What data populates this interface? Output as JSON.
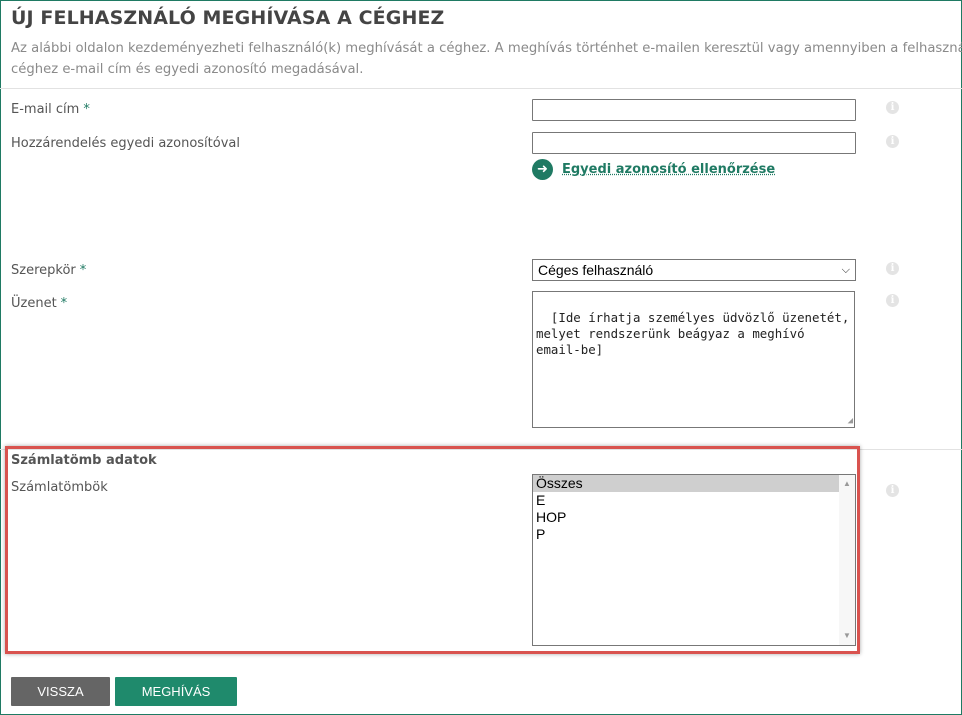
{
  "page": {
    "title": "ÚJ FELHASZNÁLÓ MEGHÍVÁSA A CÉGHEZ",
    "description_line1": "Az alábbi oldalon kezdeményezheti felhasználó(k) meghívását a céghez. A meghívás történhet e-mailen keresztül vagy amennyiben a felhasználó",
    "description_line2": "céghez e-mail cím és egyedi azonosító megadásával."
  },
  "form": {
    "email": {
      "label": "E-mail cím",
      "required": "*",
      "value": ""
    },
    "unique_id": {
      "label": "Hozzárendelés egyedi azonosítóval",
      "value": ""
    },
    "check_link": {
      "icon": "arrow-right-circle-icon",
      "label": "Egyedi azonosító ellenőrzése"
    },
    "role": {
      "label": "Szerepkör",
      "required": "*",
      "selected": "Céges felhasználó"
    },
    "message": {
      "label": "Üzenet",
      "required": "*",
      "value": "[Ide írhatja személyes üdvözlő üzenetét, melyet rendszerünk beágyaz a meghívó email-be]"
    },
    "info_icon": "i"
  },
  "invoice_section": {
    "title": "Számlatömb adatok",
    "label": "Számlatömbök",
    "options": [
      "Összes",
      "E",
      "HOP",
      "P"
    ],
    "selected": "Összes"
  },
  "buttons": {
    "back": "VISSZA",
    "invite": "MEGHÍVÁS"
  },
  "colors": {
    "accent": "#1f7a63",
    "highlight_border": "#d9534f",
    "back_button": "#656565",
    "invite_button": "#1f8a6c"
  }
}
